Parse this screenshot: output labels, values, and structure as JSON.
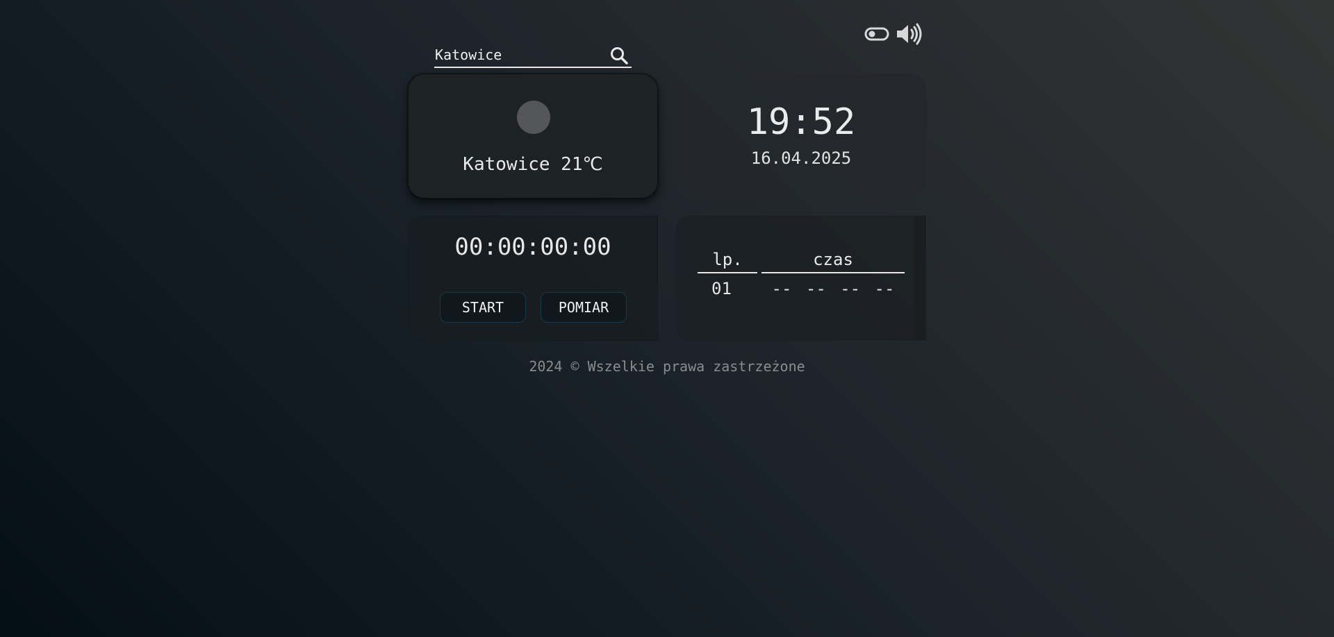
{
  "header": {
    "theme_toggle_icon": "toggle-icon",
    "sound_icon": "speaker-icon"
  },
  "search": {
    "value": "Katowice",
    "icon": "search-icon"
  },
  "weather": {
    "text": "Katowice 21℃",
    "icon": "weather-icon"
  },
  "clock": {
    "time": "19:52",
    "date": "16.04.2025"
  },
  "stopwatch": {
    "time": "00:00:00:00",
    "start_label": "START",
    "measure_label": "POMIAR"
  },
  "laps": {
    "headers": [
      "lp.",
      "czas"
    ],
    "rows": [
      [
        "01",
        "-- -- -- --"
      ]
    ]
  },
  "footer": {
    "text": "2024 © Wszelkie prawa zastrzeżone"
  },
  "colors": {
    "accent_border": "#163848",
    "text": "#e6e6e6",
    "footer_text": "#8a8d8f"
  }
}
